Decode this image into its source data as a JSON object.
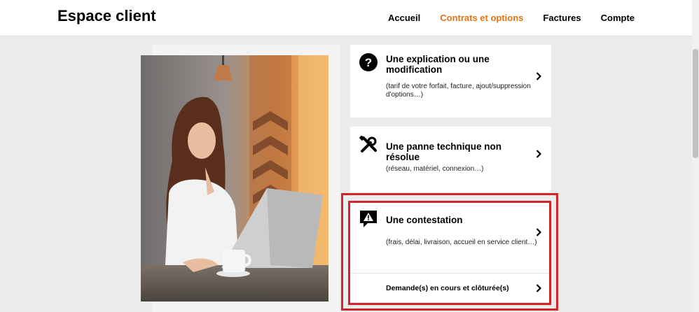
{
  "header": {
    "brand": "Espace client",
    "nav": [
      "Accueil",
      "Contrats et options",
      "Factures",
      "Compte"
    ],
    "active_index": 1
  },
  "colors": {
    "accent": "#e07410",
    "highlight": "#d0262c"
  },
  "cards": [
    {
      "icon": "question-circle-icon",
      "title": "Une explication ou une modification",
      "desc": "(tarif de votre forfait, facture, ajout/suppression d'options…)"
    },
    {
      "icon": "tools-icon",
      "title": "Une panne technique non résolue",
      "desc": "(réseau, matériel, connexion…)"
    },
    {
      "icon": "warning-speech-bubble-icon",
      "title": "Une contestation",
      "desc": "(frais, délai, livraison, accueil en service client…)",
      "link": "Demande(s) en cours et clôturée(s)"
    }
  ]
}
